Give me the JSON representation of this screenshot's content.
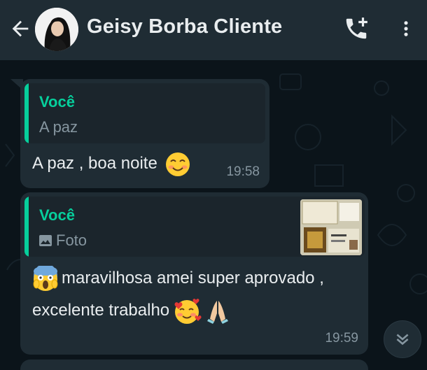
{
  "header": {
    "contact_name": "Geisy Borba Cliente",
    "back_icon": "arrow-left-icon",
    "call_icon": "add-call-icon",
    "menu_icon": "more-vert-icon"
  },
  "messages": [
    {
      "quote_author": "Você",
      "quote_text": "A paz",
      "text": "A paz , boa noite",
      "emoji": "smiling-blush-emoji",
      "time": "19:58"
    },
    {
      "quote_author": "Você",
      "quote_text": "Foto",
      "quote_icon": "photo-icon",
      "text": "maravilhosa amei super aprovado , excelente trabalho",
      "emojis": [
        "scream-emoji",
        "heart-face-emoji",
        "praying-hands-emoji"
      ],
      "time": "19:59"
    }
  ],
  "colors": {
    "header_bg": "#1f2c34",
    "chat_bg": "#0b141a",
    "bubble_bg": "#1f2c34",
    "accent": "#06cf9c",
    "text_primary": "#e9edef",
    "text_secondary": "#8696a0"
  }
}
